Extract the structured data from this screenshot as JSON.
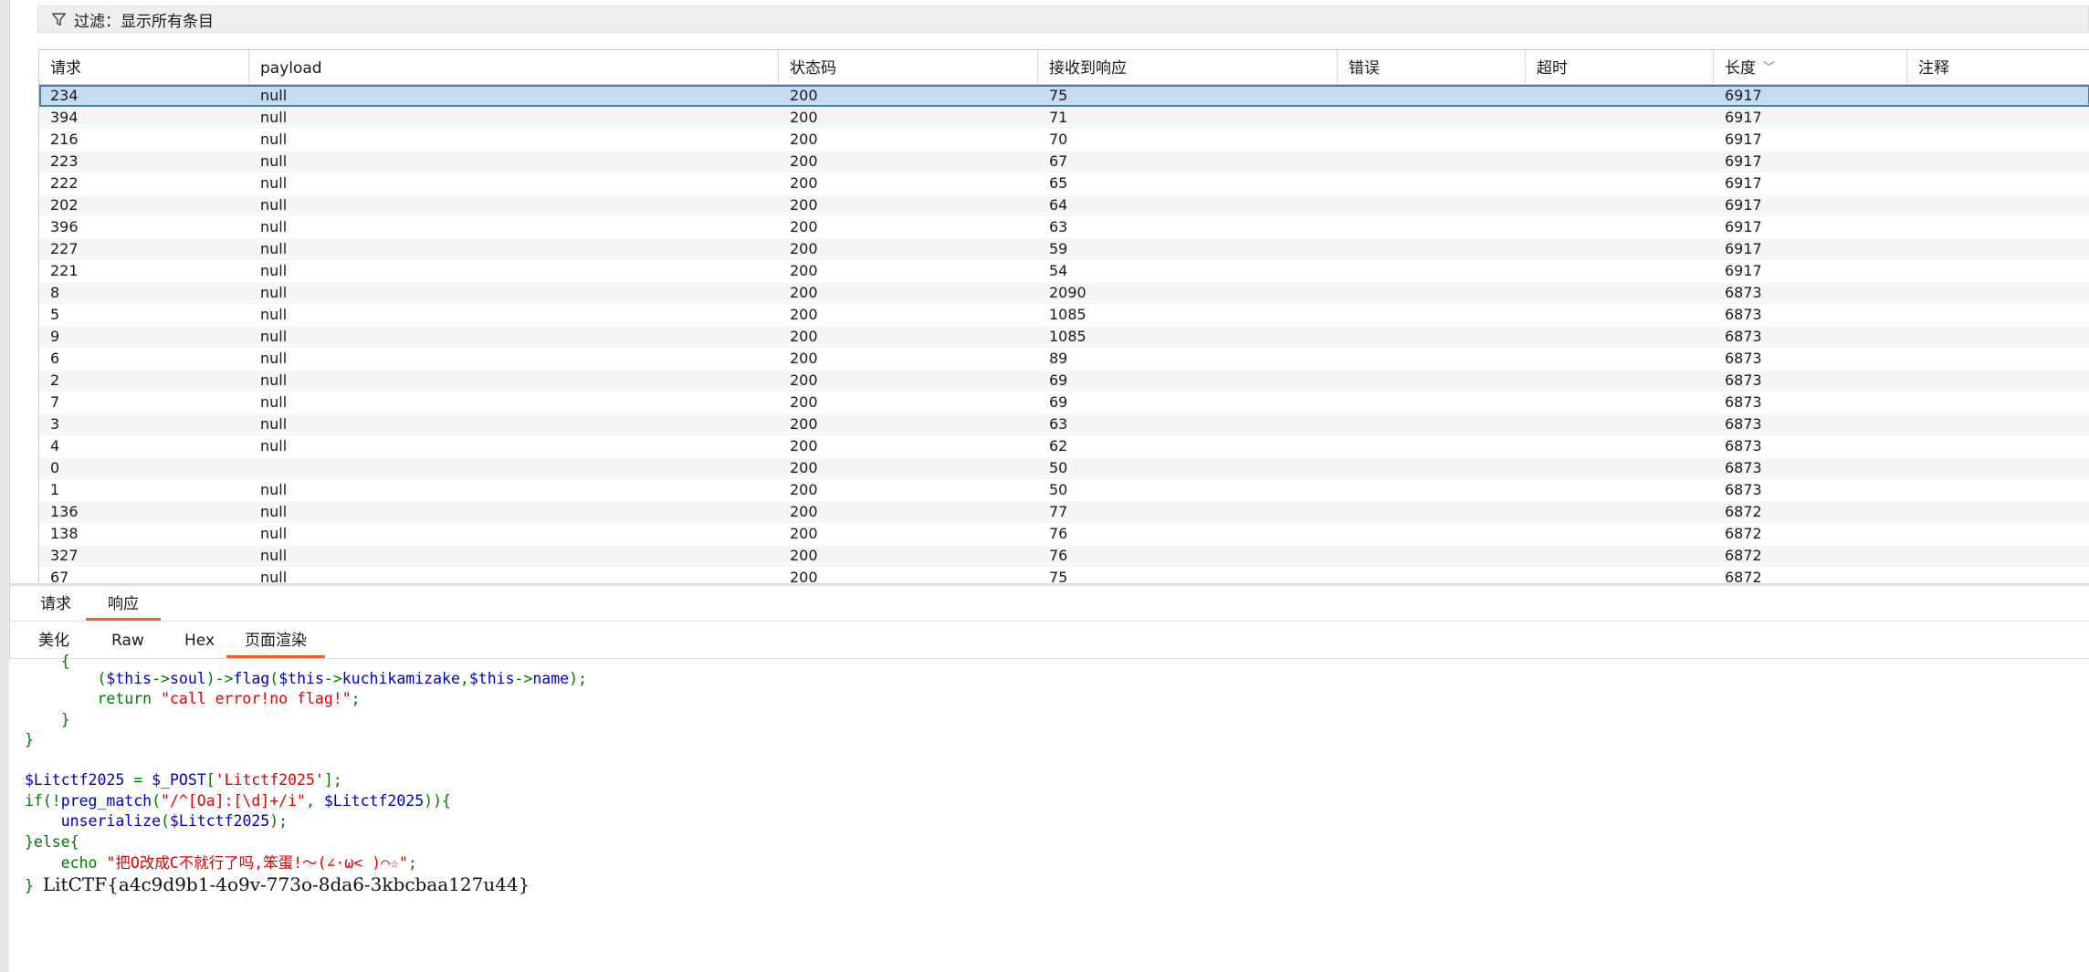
{
  "filter": {
    "label": "过滤：显示所有条目",
    "icon": "filter-icon"
  },
  "table": {
    "columns": [
      "请求",
      "payload",
      "状态码",
      "接收到响应",
      "错误",
      "超时",
      "长度",
      "注释"
    ],
    "sort_column": "长度",
    "rows": [
      [
        "234",
        "null",
        "200",
        "75",
        "",
        "",
        "6917",
        ""
      ],
      [
        "394",
        "null",
        "200",
        "71",
        "",
        "",
        "6917",
        ""
      ],
      [
        "216",
        "null",
        "200",
        "70",
        "",
        "",
        "6917",
        ""
      ],
      [
        "223",
        "null",
        "200",
        "67",
        "",
        "",
        "6917",
        ""
      ],
      [
        "222",
        "null",
        "200",
        "65",
        "",
        "",
        "6917",
        ""
      ],
      [
        "202",
        "null",
        "200",
        "64",
        "",
        "",
        "6917",
        ""
      ],
      [
        "396",
        "null",
        "200",
        "63",
        "",
        "",
        "6917",
        ""
      ],
      [
        "227",
        "null",
        "200",
        "59",
        "",
        "",
        "6917",
        ""
      ],
      [
        "221",
        "null",
        "200",
        "54",
        "",
        "",
        "6917",
        ""
      ],
      [
        "8",
        "null",
        "200",
        "2090",
        "",
        "",
        "6873",
        ""
      ],
      [
        "5",
        "null",
        "200",
        "1085",
        "",
        "",
        "6873",
        ""
      ],
      [
        "9",
        "null",
        "200",
        "1085",
        "",
        "",
        "6873",
        ""
      ],
      [
        "6",
        "null",
        "200",
        "89",
        "",
        "",
        "6873",
        ""
      ],
      [
        "2",
        "null",
        "200",
        "69",
        "",
        "",
        "6873",
        ""
      ],
      [
        "7",
        "null",
        "200",
        "69",
        "",
        "",
        "6873",
        ""
      ],
      [
        "3",
        "null",
        "200",
        "63",
        "",
        "",
        "6873",
        ""
      ],
      [
        "4",
        "null",
        "200",
        "62",
        "",
        "",
        "6873",
        ""
      ],
      [
        "0",
        "",
        "200",
        "50",
        "",
        "",
        "6873",
        ""
      ],
      [
        "1",
        "null",
        "200",
        "50",
        "",
        "",
        "6873",
        ""
      ],
      [
        "136",
        "null",
        "200",
        "77",
        "",
        "",
        "6872",
        ""
      ],
      [
        "138",
        "null",
        "200",
        "76",
        "",
        "",
        "6872",
        ""
      ],
      [
        "327",
        "null",
        "200",
        "76",
        "",
        "",
        "6872",
        ""
      ],
      [
        "67",
        "null",
        "200",
        "75",
        "",
        "",
        "6872",
        ""
      ]
    ]
  },
  "main_tabs": {
    "request": "请求",
    "response": "响应"
  },
  "sub_tabs": {
    "pretty": "美化",
    "raw": "Raw",
    "hex": "Hex",
    "render": "页面渲染"
  },
  "code": {
    "l1": "    {",
    "l2a": "        (",
    "l2b": "$this",
    "l2c": "->",
    "l2d": "soul",
    "l2e": ")->",
    "l2f": "flag",
    "l2g": "(",
    "l2h": "$this",
    "l2i": "->",
    "l2j": "kuchikamizake",
    "l2k": ",",
    "l2l": "$this",
    "l2m": "->",
    "l2n": "name",
    "l2o": ");",
    "l3a": "        return ",
    "l3b": "\"call error!no flag!\"",
    "l3c": ";",
    "l4": "    }",
    "l5": "}",
    "l7a": "$Litctf2025 ",
    "l7b": "= ",
    "l7c": "$_POST",
    "l7d": "[",
    "l7e": "'Litctf2025'",
    "l7f": "];",
    "l8a": "if(!",
    "l8b": "preg_match",
    "l8c": "(",
    "l8d": "\"/^[Oa]:[\\d]+/i\"",
    "l8e": ", ",
    "l8f": "$Litctf2025",
    "l8g": ")){",
    "l9a": "    ",
    "l9b": "unserialize",
    "l9c": "(",
    "l9d": "$Litctf2025",
    "l9e": ");",
    "l10": "}else{",
    "l11a": "    echo ",
    "l11b": "\"把O改成C不就行了吗,笨蛋!～(∠·ω< )⌒☆\"",
    "l11c": ";",
    "l12a": "} ",
    "flag": "LitCTF{a4c9d9b1-4o9v-773o-8da6-3kbcbaa127u44}"
  }
}
